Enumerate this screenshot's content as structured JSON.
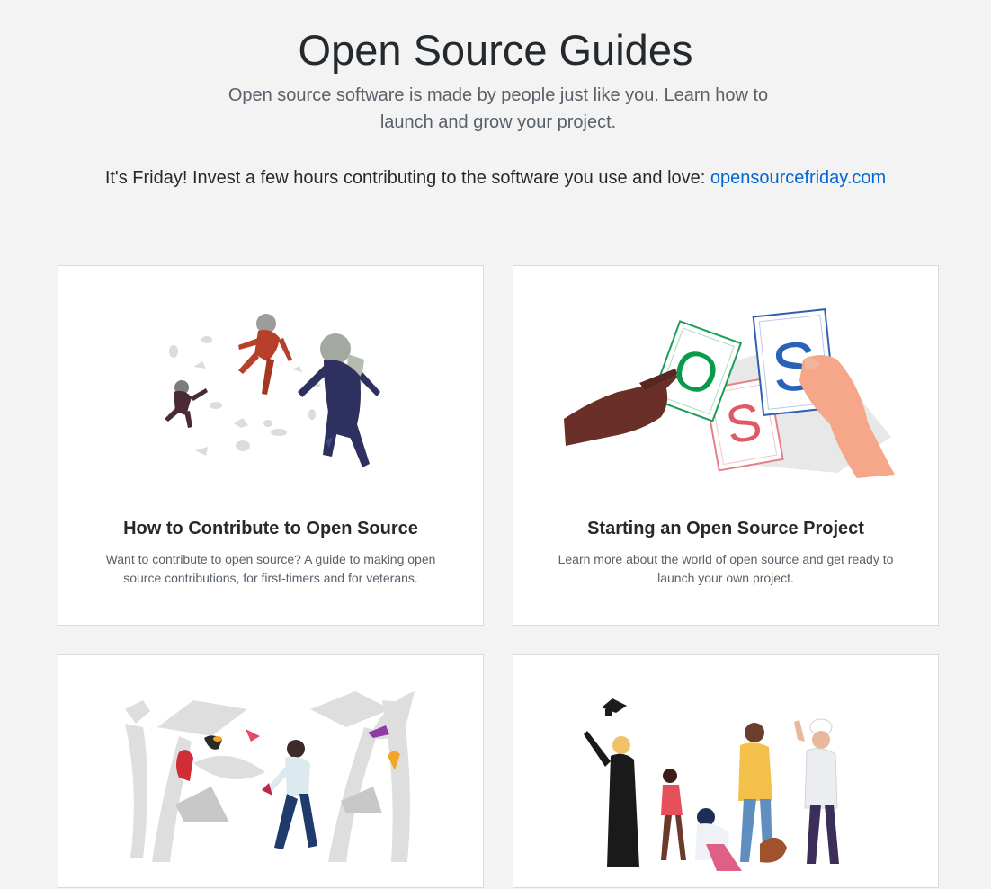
{
  "header": {
    "title": "Open Source Guides",
    "subtitle": "Open source software is made by people just like you. Learn how to launch and grow your project.",
    "friday_text": "It's Friday! Invest a few hours contributing to the software you use and love: ",
    "friday_link": "opensourcefriday.com"
  },
  "guides": [
    {
      "title": "How to Contribute to Open Source",
      "description": "Want to contribute to open source? A guide to making open source contributions, for first-timers and for veterans.",
      "illustration": "astronauts-illustration"
    },
    {
      "title": "Starting an Open Source Project",
      "description": "Learn more about the world of open source and get ready to launch your own project.",
      "illustration": "oss-cards-illustration"
    },
    {
      "title": "",
      "description": "",
      "illustration": "forest-birds-illustration"
    },
    {
      "title": "",
      "description": "",
      "illustration": "community-people-illustration"
    }
  ],
  "colors": {
    "background": "#f3f3f3",
    "link": "#0366d6",
    "card_border": "#d8dadc",
    "text": "#24292e",
    "muted": "#586069"
  }
}
